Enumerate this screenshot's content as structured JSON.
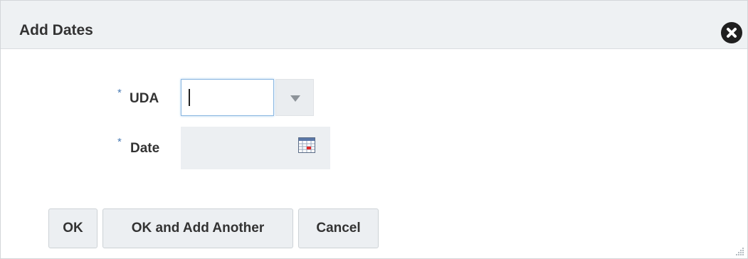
{
  "dialog": {
    "title": "Add Dates",
    "close_icon": "close-circle-icon"
  },
  "form": {
    "required_marker": "*",
    "uda": {
      "label": "UDA",
      "value": "",
      "dropdown_icon": "triangle-down-icon"
    },
    "date": {
      "label": "Date",
      "value": "",
      "calendar_icon": "calendar-icon"
    }
  },
  "buttons": {
    "ok": "OK",
    "ok_add_another": "OK and Add Another",
    "cancel": "Cancel"
  },
  "colors": {
    "required_marker": "#4a7bb5",
    "focus_border": "#8ab6e0",
    "titlebar_bg": "#eef1f3"
  }
}
